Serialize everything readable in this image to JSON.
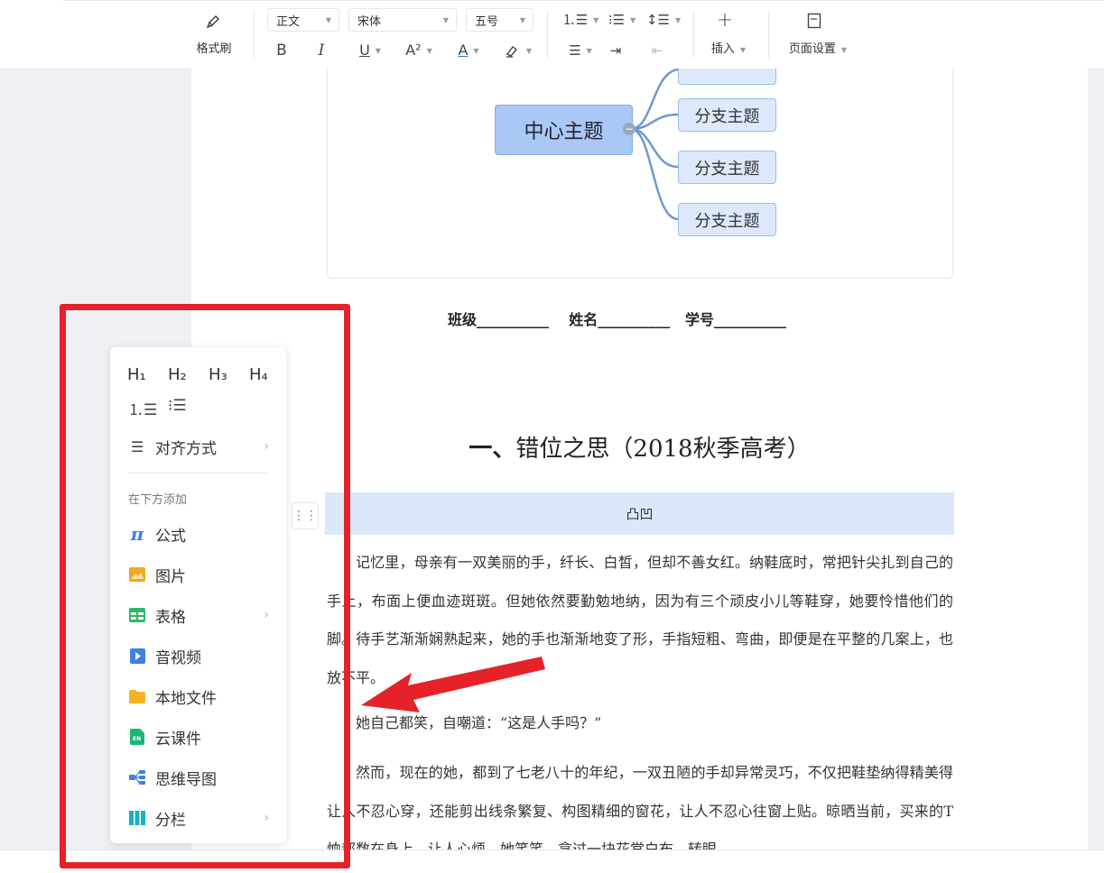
{
  "toolbar": {
    "format_painter_label": "格式刷",
    "paragraph_style": "正文",
    "font_family": "宋体",
    "font_size": "五号",
    "insert_label": "插入",
    "page_setup_label": "页面设置"
  },
  "mindmap": {
    "center_topic": "中心主题",
    "branches": [
      "分支主题",
      "分支主题",
      "分支主题"
    ]
  },
  "document": {
    "info_line": "班级__________    姓名__________   学号__________",
    "heading_prefix": "一、",
    "heading_text": "错位之思（2018秋季高考）",
    "table_cell": "凸凹",
    "paragraphs": [
      "记忆里，母亲有一双美丽的手，纤长、白皙，但却不善女红。纳鞋底时，常把针尖扎到自己的手上，布面上便血迹斑斑。但她依然要勤勉地纳，因为有三个顽皮小儿等鞋穿，她要怜惜他们的脚。待手艺渐渐娴熟起来，她的手也渐渐地变了形，手指短粗、弯曲，即便是在平整的几案上，也放不平。",
      "她自己都笑，自嘲道：“这是人手吗？”",
      "然而，现在的她，都到了七老八十的年纪，一双丑陋的手却异常灵巧，不仅把鞋垫纳得精美得让人不忍心穿，还能剪出线条繁复、构图精细的窗花，让人不忍心往窗上贴。晾晒当前，买来的T恤都数在身上，让人心烦。她笑笑，拿过一块花棠白布，转眼"
    ]
  },
  "context_menu": {
    "headings": [
      "H₁",
      "H₂",
      "H₃",
      "H₄"
    ],
    "align_label": "对齐方式",
    "section_title": "在下方添加",
    "items": [
      {
        "label": "公式",
        "icon": "pi-icon",
        "color": "#3f7ee8"
      },
      {
        "label": "图片",
        "icon": "image-icon",
        "color": "#f5a623"
      },
      {
        "label": "表格",
        "icon": "table-icon",
        "color": "#2fb66a"
      },
      {
        "label": "音视频",
        "icon": "video-icon",
        "color": "#3f7ee8"
      },
      {
        "label": "本地文件",
        "icon": "folder-icon",
        "color": "#f5b324"
      },
      {
        "label": "云课件",
        "icon": "courseware-icon",
        "color": "#19b67a"
      },
      {
        "label": "思维导图",
        "icon": "mindmap-icon",
        "color": "#3f7ee8"
      },
      {
        "label": "分栏",
        "icon": "columns-icon",
        "color": "#19b0c2"
      }
    ]
  },
  "colors": {
    "highlight_box": "#e52229",
    "accent": "#3f7ee8"
  }
}
